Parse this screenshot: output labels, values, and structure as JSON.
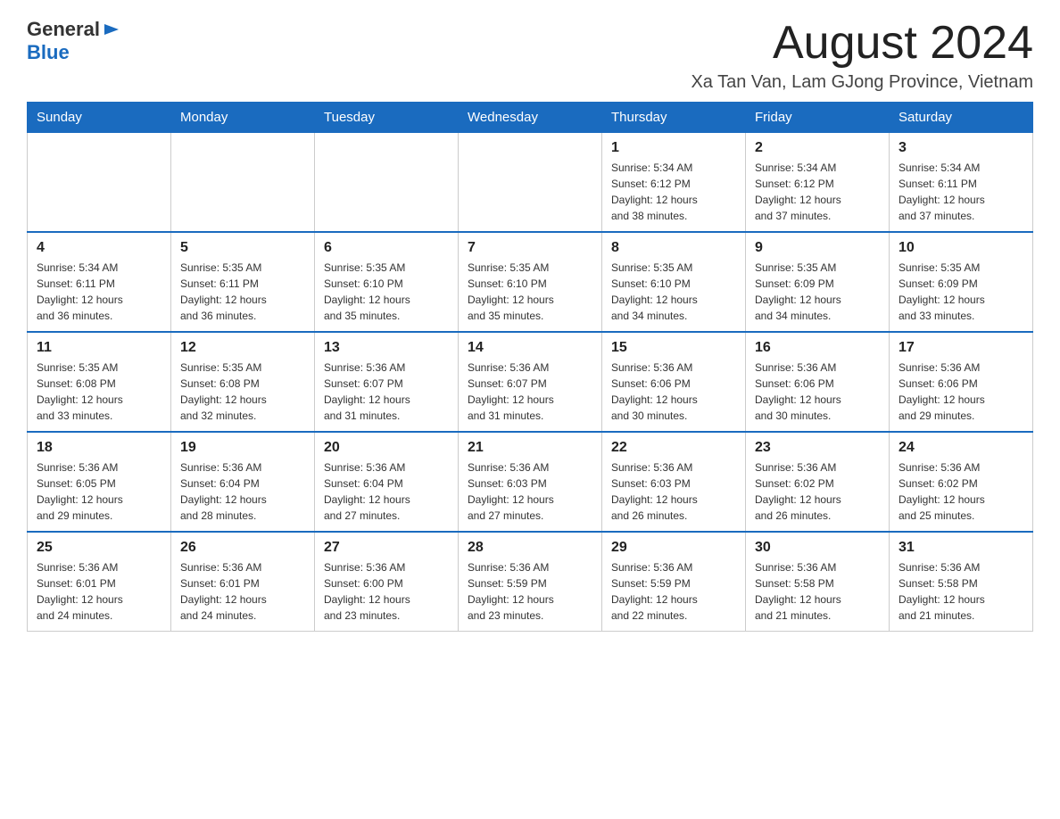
{
  "header": {
    "logo_general": "General",
    "logo_blue": "Blue",
    "month_year": "August 2024",
    "location": "Xa Tan Van, Lam GJong Province, Vietnam"
  },
  "days_of_week": [
    "Sunday",
    "Monday",
    "Tuesday",
    "Wednesday",
    "Thursday",
    "Friday",
    "Saturday"
  ],
  "weeks": [
    {
      "days": [
        {
          "num": "",
          "info": ""
        },
        {
          "num": "",
          "info": ""
        },
        {
          "num": "",
          "info": ""
        },
        {
          "num": "",
          "info": ""
        },
        {
          "num": "1",
          "info": "Sunrise: 5:34 AM\nSunset: 6:12 PM\nDaylight: 12 hours\nand 38 minutes."
        },
        {
          "num": "2",
          "info": "Sunrise: 5:34 AM\nSunset: 6:12 PM\nDaylight: 12 hours\nand 37 minutes."
        },
        {
          "num": "3",
          "info": "Sunrise: 5:34 AM\nSunset: 6:11 PM\nDaylight: 12 hours\nand 37 minutes."
        }
      ]
    },
    {
      "days": [
        {
          "num": "4",
          "info": "Sunrise: 5:34 AM\nSunset: 6:11 PM\nDaylight: 12 hours\nand 36 minutes."
        },
        {
          "num": "5",
          "info": "Sunrise: 5:35 AM\nSunset: 6:11 PM\nDaylight: 12 hours\nand 36 minutes."
        },
        {
          "num": "6",
          "info": "Sunrise: 5:35 AM\nSunset: 6:10 PM\nDaylight: 12 hours\nand 35 minutes."
        },
        {
          "num": "7",
          "info": "Sunrise: 5:35 AM\nSunset: 6:10 PM\nDaylight: 12 hours\nand 35 minutes."
        },
        {
          "num": "8",
          "info": "Sunrise: 5:35 AM\nSunset: 6:10 PM\nDaylight: 12 hours\nand 34 minutes."
        },
        {
          "num": "9",
          "info": "Sunrise: 5:35 AM\nSunset: 6:09 PM\nDaylight: 12 hours\nand 34 minutes."
        },
        {
          "num": "10",
          "info": "Sunrise: 5:35 AM\nSunset: 6:09 PM\nDaylight: 12 hours\nand 33 minutes."
        }
      ]
    },
    {
      "days": [
        {
          "num": "11",
          "info": "Sunrise: 5:35 AM\nSunset: 6:08 PM\nDaylight: 12 hours\nand 33 minutes."
        },
        {
          "num": "12",
          "info": "Sunrise: 5:35 AM\nSunset: 6:08 PM\nDaylight: 12 hours\nand 32 minutes."
        },
        {
          "num": "13",
          "info": "Sunrise: 5:36 AM\nSunset: 6:07 PM\nDaylight: 12 hours\nand 31 minutes."
        },
        {
          "num": "14",
          "info": "Sunrise: 5:36 AM\nSunset: 6:07 PM\nDaylight: 12 hours\nand 31 minutes."
        },
        {
          "num": "15",
          "info": "Sunrise: 5:36 AM\nSunset: 6:06 PM\nDaylight: 12 hours\nand 30 minutes."
        },
        {
          "num": "16",
          "info": "Sunrise: 5:36 AM\nSunset: 6:06 PM\nDaylight: 12 hours\nand 30 minutes."
        },
        {
          "num": "17",
          "info": "Sunrise: 5:36 AM\nSunset: 6:06 PM\nDaylight: 12 hours\nand 29 minutes."
        }
      ]
    },
    {
      "days": [
        {
          "num": "18",
          "info": "Sunrise: 5:36 AM\nSunset: 6:05 PM\nDaylight: 12 hours\nand 29 minutes."
        },
        {
          "num": "19",
          "info": "Sunrise: 5:36 AM\nSunset: 6:04 PM\nDaylight: 12 hours\nand 28 minutes."
        },
        {
          "num": "20",
          "info": "Sunrise: 5:36 AM\nSunset: 6:04 PM\nDaylight: 12 hours\nand 27 minutes."
        },
        {
          "num": "21",
          "info": "Sunrise: 5:36 AM\nSunset: 6:03 PM\nDaylight: 12 hours\nand 27 minutes."
        },
        {
          "num": "22",
          "info": "Sunrise: 5:36 AM\nSunset: 6:03 PM\nDaylight: 12 hours\nand 26 minutes."
        },
        {
          "num": "23",
          "info": "Sunrise: 5:36 AM\nSunset: 6:02 PM\nDaylight: 12 hours\nand 26 minutes."
        },
        {
          "num": "24",
          "info": "Sunrise: 5:36 AM\nSunset: 6:02 PM\nDaylight: 12 hours\nand 25 minutes."
        }
      ]
    },
    {
      "days": [
        {
          "num": "25",
          "info": "Sunrise: 5:36 AM\nSunset: 6:01 PM\nDaylight: 12 hours\nand 24 minutes."
        },
        {
          "num": "26",
          "info": "Sunrise: 5:36 AM\nSunset: 6:01 PM\nDaylight: 12 hours\nand 24 minutes."
        },
        {
          "num": "27",
          "info": "Sunrise: 5:36 AM\nSunset: 6:00 PM\nDaylight: 12 hours\nand 23 minutes."
        },
        {
          "num": "28",
          "info": "Sunrise: 5:36 AM\nSunset: 5:59 PM\nDaylight: 12 hours\nand 23 minutes."
        },
        {
          "num": "29",
          "info": "Sunrise: 5:36 AM\nSunset: 5:59 PM\nDaylight: 12 hours\nand 22 minutes."
        },
        {
          "num": "30",
          "info": "Sunrise: 5:36 AM\nSunset: 5:58 PM\nDaylight: 12 hours\nand 21 minutes."
        },
        {
          "num": "31",
          "info": "Sunrise: 5:36 AM\nSunset: 5:58 PM\nDaylight: 12 hours\nand 21 minutes."
        }
      ]
    }
  ]
}
